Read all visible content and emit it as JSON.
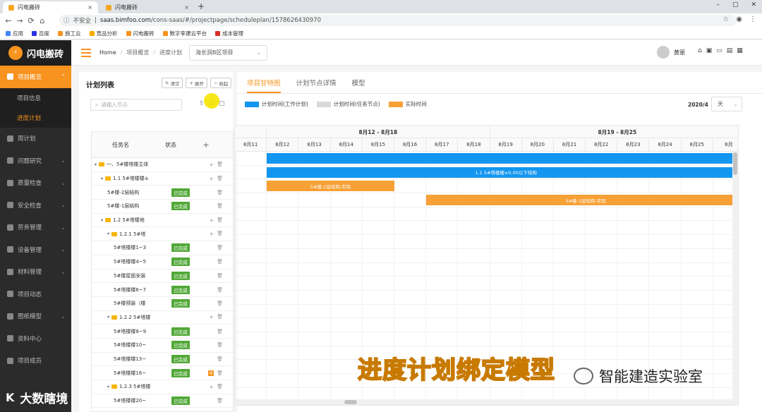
{
  "browser": {
    "tabs": [
      {
        "title": "闪电搬砖",
        "close": "×"
      },
      {
        "title": "闪电搬砖",
        "close": "×"
      }
    ],
    "new_tab": "+",
    "window_controls": [
      "–",
      "▢",
      "✕"
    ],
    "nav": [
      "←",
      "→",
      "⟳",
      "⌂"
    ],
    "security": "不安全",
    "url_host": "saas.bimfoo.com",
    "url_path": "/cons-saas/#/projectpage/scheduleplan/1578626430970",
    "bookmarks": [
      {
        "label": "应用",
        "color": "#4285f4"
      },
      {
        "label": "百度",
        "color": "#2932e1"
      },
      {
        "label": "施工云",
        "color": "#f7931e"
      },
      {
        "label": "竞品分析",
        "color": "#f9ab00"
      },
      {
        "label": "闪电搬砖",
        "color": "#f7931e"
      },
      {
        "label": "数字孪建云平台",
        "color": "#f7931e"
      },
      {
        "label": "成本管理",
        "color": "#d93025"
      }
    ]
  },
  "sidebar": {
    "logo_text": "闪电搬砖",
    "items": [
      {
        "label": "项目概览",
        "chevron": "⌃",
        "active": true
      },
      {
        "label": "项目信息",
        "sub": true,
        "current": false
      },
      {
        "label": "进度计划",
        "sub": true,
        "current": true
      },
      {
        "label": "周计划",
        "chevron": ""
      },
      {
        "label": "问题研究",
        "chevron": "⌄"
      },
      {
        "label": "质量检查",
        "chevron": "⌄"
      },
      {
        "label": "安全检查",
        "chevron": "⌄"
      },
      {
        "label": "劳务管理",
        "chevron": "⌄"
      },
      {
        "label": "设备管理",
        "chevron": "⌄"
      },
      {
        "label": "材料管理",
        "chevron": "⌄"
      },
      {
        "label": "项目动态",
        "chevron": ""
      },
      {
        "label": "图纸模型",
        "chevron": "⌄"
      },
      {
        "label": "资料中心",
        "chevron": ""
      },
      {
        "label": "项目成员",
        "chevron": ""
      }
    ]
  },
  "topbar": {
    "breadcrumb": [
      "Home",
      "项目概览",
      "进度计划"
    ],
    "project": "海长洞B区项目",
    "user": "黄丽",
    "icons": [
      "⌂",
      "▣",
      "▭",
      "▤",
      "▦"
    ]
  },
  "left_panel": {
    "title": "计划列表",
    "buttons": [
      {
        "icon": "✎",
        "label": "清空"
      },
      {
        "icon": "+",
        "label": "展开"
      },
      {
        "icon": "−",
        "label": "收起"
      }
    ],
    "search_placeholder": "请输入节点",
    "tools": [
      "⇧",
      "▤",
      "▢"
    ],
    "tree_header": {
      "name": "任务名",
      "status": "状态",
      "add": "+"
    },
    "rows": [
      {
        "indent": 0,
        "caret": "▾",
        "folder": true,
        "name": "一、5#楼塔楼主体",
        "status": "",
        "add": true,
        "flag": false
      },
      {
        "indent": 1,
        "caret": "▾",
        "folder": true,
        "name": "1.1 5#塔楼楼±",
        "status": "",
        "add": true,
        "flag": false
      },
      {
        "indent": 2,
        "caret": "",
        "folder": false,
        "name": "5#楼-2层结构",
        "status": "已完成",
        "add": false,
        "flag": false
      },
      {
        "indent": 2,
        "caret": "",
        "folder": false,
        "name": "5#楼-1层结构",
        "status": "已完成",
        "add": false,
        "flag": false
      },
      {
        "indent": 1,
        "caret": "▾",
        "folder": true,
        "name": "1.2 5#塔楼地",
        "status": "",
        "add": true,
        "flag": false
      },
      {
        "indent": 2,
        "caret": "▾",
        "folder": true,
        "name": "1.2.1 5#塔",
        "status": "",
        "add": true,
        "flag": false
      },
      {
        "indent": 3,
        "caret": "",
        "folder": false,
        "name": "5#塔楼楼1~3",
        "status": "已完成",
        "add": false,
        "flag": false
      },
      {
        "indent": 3,
        "caret": "",
        "folder": false,
        "name": "5#塔楼楼4~5",
        "status": "已完成",
        "add": false,
        "flag": false
      },
      {
        "indent": 3,
        "caret": "",
        "folder": false,
        "name": "5#楼屋面安装",
        "status": "已完成",
        "add": false,
        "flag": false
      },
      {
        "indent": 3,
        "caret": "",
        "folder": false,
        "name": "5#塔楼楼6~7",
        "status": "已完成",
        "add": false,
        "flag": false
      },
      {
        "indent": 3,
        "caret": "",
        "folder": false,
        "name": "5#楼预装（楼",
        "status": "已完成",
        "add": false,
        "flag": false
      },
      {
        "indent": 2,
        "caret": "▾",
        "folder": true,
        "name": "1.2.2 5#塔楼",
        "status": "",
        "add": true,
        "flag": false
      },
      {
        "indent": 3,
        "caret": "",
        "folder": false,
        "name": "5#塔楼楼8~9",
        "status": "已完成",
        "add": false,
        "flag": false
      },
      {
        "indent": 3,
        "caret": "",
        "folder": false,
        "name": "5#塔楼楼10~",
        "status": "已完成",
        "add": false,
        "flag": false
      },
      {
        "indent": 3,
        "caret": "",
        "folder": false,
        "name": "5#塔楼楼13~",
        "status": "已完成",
        "add": false,
        "flag": false
      },
      {
        "indent": 3,
        "caret": "",
        "folder": false,
        "name": "5#塔楼楼16~",
        "status": "已完成",
        "add": false,
        "flag": true
      },
      {
        "indent": 2,
        "caret": "▾",
        "folder": true,
        "name": "1.2.3 5#塔楼",
        "status": "",
        "add": true,
        "flag": false
      },
      {
        "indent": 3,
        "caret": "",
        "folder": false,
        "name": "5#塔楼楼20~",
        "status": "已完成",
        "add": false,
        "flag": false
      }
    ]
  },
  "right_panel": {
    "tabs": [
      "项目甘特图",
      "计划节点详情",
      "模型"
    ],
    "active_tab": 0,
    "legend": [
      {
        "label": "计划时间(工作计划)",
        "color": "#1296f0"
      },
      {
        "label": "计划时间(任务节点)",
        "color": "#d9d9d9"
      },
      {
        "label": "实际时间",
        "color": "#f7a035"
      }
    ],
    "month": "2020/4",
    "unit": "天",
    "weeks": [
      "",
      "8月12 - 8月18",
      "8月19 - 8月25"
    ],
    "days": [
      "8月11",
      "8月12",
      "8月13",
      "8月14",
      "8月15",
      "8月16",
      "8月17",
      "8月18",
      "8月19",
      "8月20",
      "8月21",
      "8月22",
      "8月23",
      "8月24",
      "8月25",
      "8月"
    ],
    "bars": [
      {
        "row": 0,
        "start": 1,
        "span": 15,
        "color": "#1296f0",
        "label": ""
      },
      {
        "row": 1,
        "start": 1,
        "span": 15,
        "color": "#1296f0",
        "label": "1.1 5#塔楼楼±0.00以下结构"
      },
      {
        "row": 2,
        "start": 1,
        "span": 4,
        "color": "#f7a035",
        "label": "5#楼-2层结构-实际"
      },
      {
        "row": 3,
        "start": 6,
        "span": 10,
        "color": "#f7a035",
        "label": "5#楼-1层结构-实际"
      }
    ],
    "row_count": 18
  },
  "overlay": {
    "caption": "进度计划绑定模型",
    "watermark": "智能建造实验室",
    "bottom_logo": "大数瞎境",
    "bottom_logo_mark": "K"
  }
}
